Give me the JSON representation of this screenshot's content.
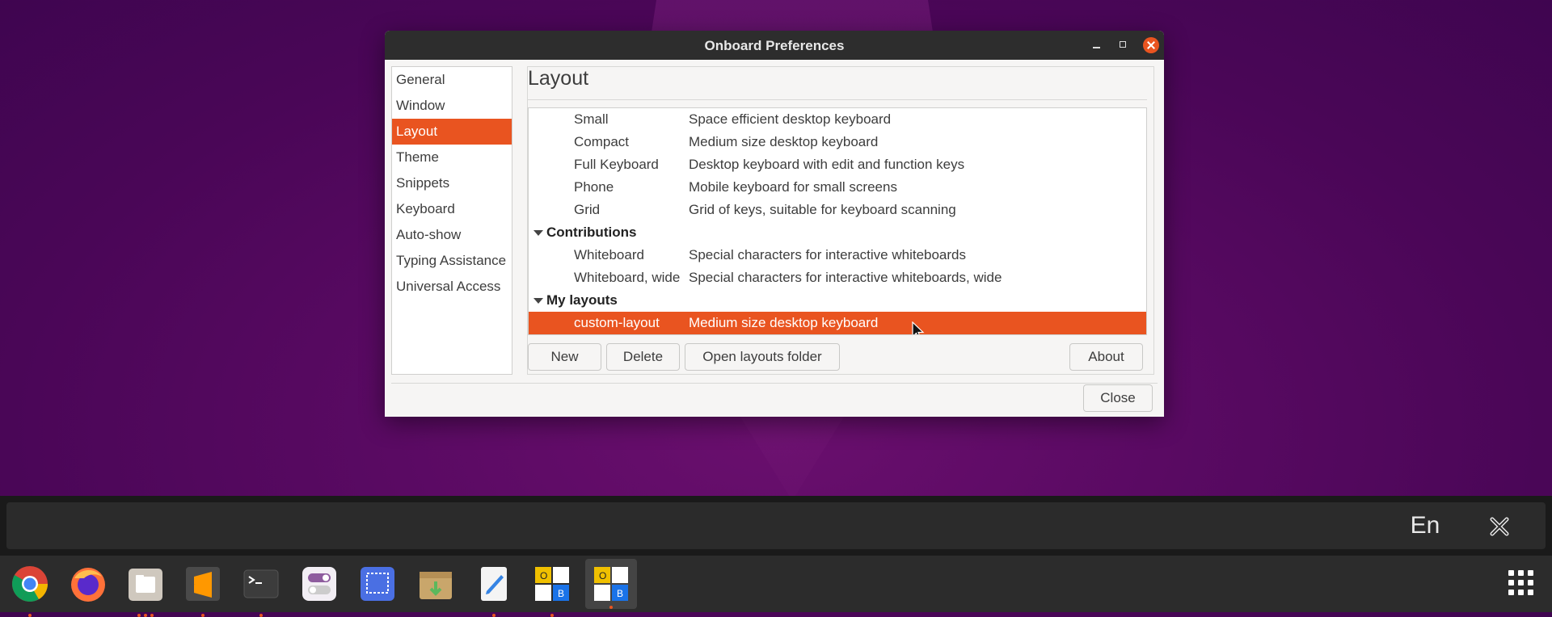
{
  "window": {
    "title": "Onboard Preferences"
  },
  "sidebar": {
    "items": [
      {
        "label": "General"
      },
      {
        "label": "Window"
      },
      {
        "label": "Layout"
      },
      {
        "label": "Theme"
      },
      {
        "label": "Snippets"
      },
      {
        "label": "Keyboard"
      },
      {
        "label": "Auto-show"
      },
      {
        "label": "Typing Assistance"
      },
      {
        "label": "Universal Access"
      }
    ],
    "active_index": 2
  },
  "main": {
    "title": "Layout",
    "layouts": [
      {
        "name": "Small",
        "description": "Space efficient desktop keyboard"
      },
      {
        "name": "Compact",
        "description": "Medium size desktop keyboard"
      },
      {
        "name": "Full Keyboard",
        "description": "Desktop keyboard with edit and function keys"
      },
      {
        "name": "Phone",
        "description": "Mobile keyboard for small screens"
      },
      {
        "name": "Grid",
        "description": "Grid of keys, suitable for keyboard scanning"
      }
    ],
    "groups": [
      {
        "label": "Contributions",
        "items": [
          {
            "name": "Whiteboard",
            "description": "Special characters for interactive whiteboards"
          },
          {
            "name": "Whiteboard, wide",
            "description": "Special characters for interactive whiteboards, wide"
          }
        ]
      },
      {
        "label": "My layouts",
        "items": [
          {
            "name": "custom-layout",
            "description": "Medium size desktop keyboard",
            "selected": true
          }
        ]
      }
    ],
    "buttons": {
      "new": "New",
      "delete": "Delete",
      "open_folder": "Open layouts folder",
      "about": "About"
    }
  },
  "footer": {
    "close": "Close"
  },
  "keyboard": {
    "language": "En"
  },
  "dock": {
    "apps": [
      "chrome-icon",
      "firefox-icon",
      "files-icon",
      "sublime-text-icon",
      "terminal-icon",
      "tweaks-icon",
      "screenshot-icon",
      "archive-manager-icon",
      "text-editor-icon",
      "onboard-settings-icon",
      "onboard-icon"
    ],
    "accent": "#e95420"
  }
}
